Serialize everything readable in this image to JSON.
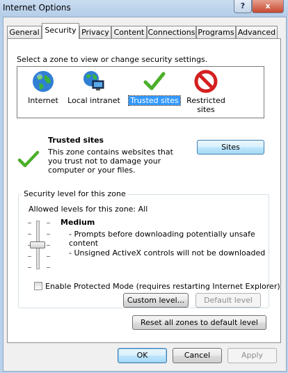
{
  "window": {
    "title": "Internet Options"
  },
  "titlebar": {
    "help_glyph": "?",
    "close_glyph": "x"
  },
  "tabs": [
    {
      "label": "General"
    },
    {
      "label": "Security"
    },
    {
      "label": "Privacy"
    },
    {
      "label": "Content"
    },
    {
      "label": "Connections"
    },
    {
      "label": "Programs"
    },
    {
      "label": "Advanced"
    }
  ],
  "active_tab": "Security",
  "security": {
    "instruction": "Select a zone to view or change security settings.",
    "zones": [
      {
        "label": "Internet",
        "icon": "globe-icon"
      },
      {
        "label": "Local intranet",
        "icon": "intranet-icon"
      },
      {
        "label": "Trusted sites",
        "icon": "checkmark-icon",
        "selected": true
      },
      {
        "label": "Restricted sites",
        "icon": "restricted-icon"
      }
    ],
    "zone_detail": {
      "title": "Trusted sites",
      "description": "This zone contains websites that you trust not to damage your computer or your files.",
      "sites_button": "Sites"
    },
    "level_group": {
      "title": "Security level for this zone",
      "allowed": "Allowed levels for this zone: All",
      "level_name": "Medium",
      "bullets": [
        "- Prompts before downloading potentially unsafe content",
        "- Unsigned ActiveX controls will not be downloaded"
      ],
      "protected_mode_label": "Enable Protected Mode (requires restarting Internet Explorer)",
      "protected_mode_checked": false,
      "custom_level_button": "Custom level...",
      "default_level_button": "Default level"
    },
    "reset_button": "Reset all zones to default level"
  },
  "footer": {
    "ok": "OK",
    "cancel": "Cancel",
    "apply": "Apply"
  },
  "colors": {
    "selection": "#3399ff",
    "accent_button": "#bee6fd",
    "trusted_check": "#4caf2a",
    "restricted": "#d42020"
  }
}
